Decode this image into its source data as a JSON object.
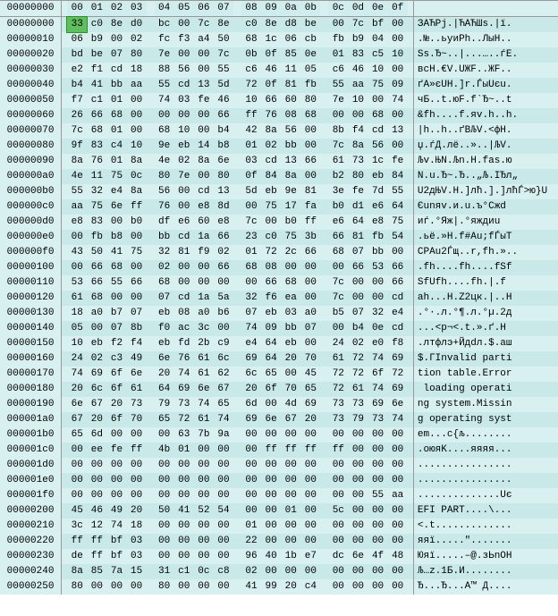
{
  "header": {
    "offset_label": "00000000",
    "cols": [
      "00",
      "01",
      "02",
      "03",
      "04",
      "05",
      "06",
      "07",
      "08",
      "09",
      "0a",
      "0b",
      "0c",
      "0d",
      "0e",
      "0f"
    ],
    "ascii_label": ""
  },
  "selected": {
    "row": 0,
    "col": 0
  },
  "rows": [
    {
      "o": "00000000",
      "h": [
        "33",
        "c0",
        "8e",
        "d0",
        "bc",
        "00",
        "7c",
        "8e",
        "c0",
        "8e",
        "d8",
        "be",
        "00",
        "7c",
        "bf",
        "00"
      ],
      "a": "ЗАЋРј.|ЋАЋШѕ.|ї."
    },
    {
      "o": "00000010",
      "h": [
        "06",
        "b9",
        "00",
        "02",
        "fc",
        "f3",
        "a4",
        "50",
        "68",
        "1c",
        "06",
        "cb",
        "fb",
        "b9",
        "04",
        "00"
      ],
      "a": ".№..ьуиPh..ЛыН.."
    },
    {
      "o": "00000020",
      "h": [
        "bd",
        "be",
        "07",
        "80",
        "7e",
        "00",
        "00",
        "7c",
        "0b",
        "0f",
        "85",
        "0e",
        "01",
        "83",
        "c5",
        "10"
      ],
      "a": "Sѕ.Ђ~..|...…..ѓЕ."
    },
    {
      "o": "00000030",
      "h": [
        "e2",
        "f1",
        "cd",
        "18",
        "88",
        "56",
        "00",
        "55",
        "c6",
        "46",
        "11",
        "05",
        "c6",
        "46",
        "10",
        "00"
      ],
      "a": "всН.€V.UЖF..ЖF.."
    },
    {
      "o": "00000040",
      "h": [
        "b4",
        "41",
        "bb",
        "aa",
        "55",
        "cd",
        "13",
        "5d",
        "72",
        "0f",
        "81",
        "fb",
        "55",
        "aa",
        "75",
        "09"
      ],
      "a": "ґА»єUН.]r.ЃыUєu."
    },
    {
      "o": "00000050",
      "h": [
        "f7",
        "c1",
        "01",
        "00",
        "74",
        "03",
        "fe",
        "46",
        "10",
        "66",
        "60",
        "80",
        "7e",
        "10",
        "00",
        "74"
      ],
      "a": "чБ..t.юF.f`Ђ~..t"
    },
    {
      "o": "00000060",
      "h": [
        "26",
        "66",
        "68",
        "00",
        "00",
        "00",
        "00",
        "66",
        "ff",
        "76",
        "08",
        "68",
        "00",
        "00",
        "68",
        "00"
      ],
      "a": "&fh....f.яv.h..h."
    },
    {
      "o": "00000070",
      "h": [
        "7c",
        "68",
        "01",
        "00",
        "68",
        "10",
        "00",
        "b4",
        "42",
        "8a",
        "56",
        "00",
        "8b",
        "f4",
        "cd",
        "13"
      ],
      "a": "|h..h..ґBЉV.<фН."
    },
    {
      "o": "00000080",
      "h": [
        "9f",
        "83",
        "c4",
        "10",
        "9e",
        "eb",
        "14",
        "b8",
        "01",
        "02",
        "bb",
        "00",
        "7c",
        "8a",
        "56",
        "00"
      ],
      "a": "џ.ѓД.лё..»..|ЉV."
    },
    {
      "o": "00000090",
      "h": [
        "8a",
        "76",
        "01",
        "8a",
        "4e",
        "02",
        "8a",
        "6e",
        "03",
        "cd",
        "13",
        "66",
        "61",
        "73",
        "1c",
        "fe"
      ],
      "a": "Љv.ЊN.Љn.Н.fas.ю"
    },
    {
      "o": "000000a0",
      "h": [
        "4e",
        "11",
        "75",
        "0c",
        "80",
        "7e",
        "00",
        "80",
        "0f",
        "84",
        "8a",
        "00",
        "b2",
        "80",
        "eb",
        "84"
      ],
      "a": "N.u.Ђ~.Ђ..„Љ.ІЂл„"
    },
    {
      "o": "000000b0",
      "h": [
        "55",
        "32",
        "e4",
        "8a",
        "56",
        "00",
        "cd",
        "13",
        "5d",
        "eb",
        "9e",
        "81",
        "3e",
        "fe",
        "7d",
        "55"
      ],
      "a": "U2дЊV.Н.]лћ.].]лћЃ>ю}U"
    },
    {
      "o": "000000c0",
      "h": [
        "aa",
        "75",
        "6e",
        "ff",
        "76",
        "00",
        "e8",
        "8d",
        "00",
        "75",
        "17",
        "fa",
        "b0",
        "d1",
        "e6",
        "64"
      ],
      "a": "Єunяv.и.u.ъ°Сжd"
    },
    {
      "o": "000000d0",
      "h": [
        "e8",
        "83",
        "00",
        "b0",
        "df",
        "e6",
        "60",
        "e8",
        "7c",
        "00",
        "b0",
        "ff",
        "e6",
        "64",
        "e8",
        "75"
      ],
      "a": "иѓ.°Яж|.°яждиu"
    },
    {
      "o": "000000e0",
      "h": [
        "00",
        "fb",
        "b8",
        "00",
        "bb",
        "cd",
        "1a",
        "66",
        "23",
        "c0",
        "75",
        "3b",
        "66",
        "81",
        "fb",
        "54"
      ],
      "a": ".ьё.»Н.f#Аu;fЃыT"
    },
    {
      "o": "000000f0",
      "h": [
        "43",
        "50",
        "41",
        "75",
        "32",
        "81",
        "f9",
        "02",
        "01",
        "72",
        "2c",
        "66",
        "68",
        "07",
        "bb",
        "00"
      ],
      "a": "CPAu2Ѓщ..r,fh.».."
    },
    {
      "o": "00000100",
      "h": [
        "00",
        "66",
        "68",
        "00",
        "02",
        "00",
        "00",
        "66",
        "68",
        "08",
        "00",
        "00",
        "00",
        "66",
        "53",
        "66"
      ],
      "a": ".fh....fh....fSf"
    },
    {
      "o": "00000110",
      "h": [
        "53",
        "66",
        "55",
        "66",
        "68",
        "00",
        "00",
        "00",
        "00",
        "66",
        "68",
        "00",
        "7c",
        "00",
        "00",
        "66"
      ],
      "a": "SfUfh....fh.|.f"
    },
    {
      "o": "00000120",
      "h": [
        "61",
        "68",
        "00",
        "00",
        "07",
        "cd",
        "1a",
        "5a",
        "32",
        "f6",
        "ea",
        "00",
        "7c",
        "00",
        "00",
        "cd"
      ],
      "a": "аh...Н.Z2цк.|..Н"
    },
    {
      "o": "00000130",
      "h": [
        "18",
        "a0",
        "b7",
        "07",
        "eb",
        "08",
        "a0",
        "b6",
        "07",
        "eb",
        "03",
        "a0",
        "b5",
        "07",
        "32",
        "e4"
      ],
      "a": ".°·.л.°¶.л.°µ.2д"
    },
    {
      "o": "00000140",
      "h": [
        "05",
        "00",
        "07",
        "8b",
        "f0",
        "ac",
        "3c",
        "00",
        "74",
        "09",
        "bb",
        "07",
        "00",
        "b4",
        "0e",
        "cd"
      ],
      "a": "...<р¬<.t.».ґ.Н"
    },
    {
      "o": "00000150",
      "h": [
        "10",
        "eb",
        "f2",
        "f4",
        "eb",
        "fd",
        "2b",
        "c9",
        "e4",
        "64",
        "eb",
        "00",
        "24",
        "02",
        "e0",
        "f8"
      ],
      "a": ".лтфлэ+Йдdл.$.аш"
    },
    {
      "o": "00000160",
      "h": [
        "24",
        "02",
        "c3",
        "49",
        "6e",
        "76",
        "61",
        "6c",
        "69",
        "64",
        "20",
        "70",
        "61",
        "72",
        "74",
        "69"
      ],
      "a": "$.ГInvalid parti"
    },
    {
      "o": "00000170",
      "h": [
        "74",
        "69",
        "6f",
        "6e",
        "20",
        "74",
        "61",
        "62",
        "6c",
        "65",
        "00",
        "45",
        "72",
        "72",
        "6f",
        "72"
      ],
      "a": "tion table.Error"
    },
    {
      "o": "00000180",
      "h": [
        "20",
        "6c",
        "6f",
        "61",
        "64",
        "69",
        "6e",
        "67",
        "20",
        "6f",
        "70",
        "65",
        "72",
        "61",
        "74",
        "69"
      ],
      "a": " loading operati"
    },
    {
      "o": "00000190",
      "h": [
        "6e",
        "67",
        "20",
        "73",
        "79",
        "73",
        "74",
        "65",
        "6d",
        "00",
        "4d",
        "69",
        "73",
        "73",
        "69",
        "6e"
      ],
      "a": "ng system.Missin"
    },
    {
      "o": "000001a0",
      "h": [
        "67",
        "20",
        "6f",
        "70",
        "65",
        "72",
        "61",
        "74",
        "69",
        "6e",
        "67",
        "20",
        "73",
        "79",
        "73",
        "74"
      ],
      "a": "g operating syst"
    },
    {
      "o": "000001b0",
      "h": [
        "65",
        "6d",
        "00",
        "00",
        "00",
        "63",
        "7b",
        "9a",
        "00",
        "00",
        "00",
        "00",
        "00",
        "00",
        "00",
        "00"
      ],
      "a": "em...c{љ........"
    },
    {
      "o": "000001c0",
      "h": [
        "00",
        "ee",
        "fe",
        "ff",
        "4b",
        "01",
        "00",
        "00",
        "00",
        "ff",
        "ff",
        "ff",
        "ff",
        "00",
        "00",
        "00"
      ],
      "a": ".оюяK....яяяя..."
    },
    {
      "o": "000001d0",
      "h": [
        "00",
        "00",
        "00",
        "00",
        "00",
        "00",
        "00",
        "00",
        "00",
        "00",
        "00",
        "00",
        "00",
        "00",
        "00",
        "00"
      ],
      "a": "................"
    },
    {
      "o": "000001e0",
      "h": [
        "00",
        "00",
        "00",
        "00",
        "00",
        "00",
        "00",
        "00",
        "00",
        "00",
        "00",
        "00",
        "00",
        "00",
        "00",
        "00"
      ],
      "a": "................"
    },
    {
      "o": "000001f0",
      "h": [
        "00",
        "00",
        "00",
        "00",
        "00",
        "00",
        "00",
        "00",
        "00",
        "00",
        "00",
        "00",
        "00",
        "00",
        "55",
        "aa"
      ],
      "a": "..............Uє"
    },
    {
      "o": "00000200",
      "h": [
        "45",
        "46",
        "49",
        "20",
        "50",
        "41",
        "52",
        "54",
        "00",
        "00",
        "01",
        "00",
        "5c",
        "00",
        "00",
        "00"
      ],
      "a": "EFI PART....\\..."
    },
    {
      "o": "00000210",
      "h": [
        "3c",
        "12",
        "74",
        "18",
        "00",
        "00",
        "00",
        "00",
        "01",
        "00",
        "00",
        "00",
        "00",
        "00",
        "00",
        "00"
      ],
      "a": "<.t............."
    },
    {
      "o": "00000220",
      "h": [
        "ff",
        "ff",
        "bf",
        "03",
        "00",
        "00",
        "00",
        "00",
        "22",
        "00",
        "00",
        "00",
        "00",
        "00",
        "00",
        "00"
      ],
      "a": "яяї.....\"......."
    },
    {
      "o": "00000230",
      "h": [
        "de",
        "ff",
        "bf",
        "03",
        "00",
        "00",
        "00",
        "00",
        "96",
        "40",
        "1b",
        "e7",
        "dc",
        "6e",
        "4f",
        "48"
      ],
      "a": "Юяї.....–@.зЬnOH"
    },
    {
      "o": "00000240",
      "h": [
        "8a",
        "85",
        "7a",
        "15",
        "31",
        "c1",
        "0c",
        "c8",
        "02",
        "00",
        "00",
        "00",
        "00",
        "00",
        "00",
        "00"
      ],
      "a": "Љ…z.1Б.И........"
    },
    {
      "o": "00000250",
      "h": [
        "80",
        "00",
        "00",
        "00",
        "80",
        "00",
        "00",
        "00",
        "41",
        "99",
        "20",
        "c4",
        "00",
        "00",
        "00",
        "00"
      ],
      "a": "Ђ...Ђ...A™ Д...."
    }
  ]
}
